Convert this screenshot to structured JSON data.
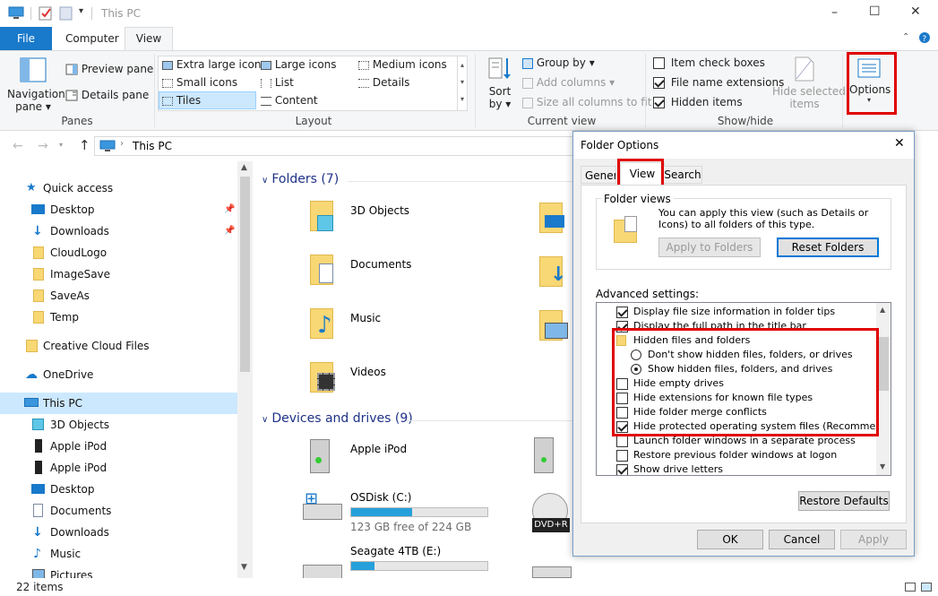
{
  "window": {
    "title": "This PC",
    "controls": [
      "–",
      "☐",
      "✕"
    ]
  },
  "ribbon": {
    "tabs": {
      "file": "File",
      "computer": "Computer",
      "view": "View"
    },
    "panes": {
      "navigation": "Navigation pane",
      "nav_line1": "Navigation",
      "nav_line2": "pane",
      "preview": "Preview pane",
      "details": "Details pane",
      "label": "Panes"
    },
    "layout": {
      "extra_large": "Extra large icons",
      "large": "Large icons",
      "medium": "Medium icons",
      "small": "Small icons",
      "list": "List",
      "details": "Details",
      "tiles": "Tiles",
      "content": "Content",
      "label": "Layout"
    },
    "current_view": {
      "sort1": "Sort",
      "sort2": "by",
      "group_by": "Group by",
      "add_columns": "Add columns",
      "size_all": "Size all columns to fit",
      "label": "Current view"
    },
    "show_hide": {
      "item_check_boxes": "Item check boxes",
      "file_name_ext": "File name extensions",
      "hidden_items": "Hidden items",
      "hide_selected1": "Hide selected",
      "hide_selected2": "items",
      "label": "Show/hide"
    },
    "options": {
      "label": "Options"
    }
  },
  "address": {
    "path": "This PC"
  },
  "nav": {
    "quick_access": "Quick access",
    "items": [
      "Desktop",
      "Downloads",
      "CloudLogo",
      "ImageSave",
      "SaveAs",
      "Temp"
    ],
    "creative_cloud": "Creative Cloud Files",
    "onedrive": "OneDrive",
    "this_pc": "This PC",
    "pc_items": [
      "3D Objects",
      "Apple iPod",
      "Apple iPod",
      "Desktop",
      "Documents",
      "Downloads",
      "Music",
      "Pictures"
    ]
  },
  "content": {
    "folders_header": "Folders (7)",
    "folders": [
      "3D Objects",
      "Documents",
      "Music",
      "Videos"
    ],
    "devices_header": "Devices and drives (9)",
    "devices": [
      {
        "name": "Apple iPod",
        "free": ""
      },
      {
        "name": "OSDisk (C:)",
        "free": "123 GB free of 224 GB",
        "fill": 0.45
      },
      {
        "name": "Seagate 4TB (E:)",
        "free": "",
        "fill": 0.17
      }
    ],
    "dvd_label": "DVD+R"
  },
  "status": {
    "items": "22 items"
  },
  "dialog": {
    "title": "Folder Options",
    "tabs": {
      "general": "General",
      "view": "View",
      "search": "Search"
    },
    "folder_views": {
      "label": "Folder views",
      "description": "You can apply this view (such as Details or Icons) to all folders of this type.",
      "apply_button": "Apply to Folders",
      "reset_button": "Reset Folders"
    },
    "advanced_label": "Advanced settings:",
    "settings": [
      {
        "text": "Display file size information in folder tips",
        "kind": "check",
        "on": true
      },
      {
        "text": "Display the full path in the title bar",
        "kind": "check",
        "on": true
      },
      {
        "text": "Hidden files and folders",
        "kind": "folder",
        "on": false
      },
      {
        "text": "Don't show hidden files, folders, or drives",
        "kind": "radio",
        "on": false
      },
      {
        "text": "Show hidden files, folders, and drives",
        "kind": "radio",
        "on": true
      },
      {
        "text": "Hide empty drives",
        "kind": "check",
        "on": false
      },
      {
        "text": "Hide extensions for known file types",
        "kind": "check",
        "on": false
      },
      {
        "text": "Hide folder merge conflicts",
        "kind": "check",
        "on": false
      },
      {
        "text": "Hide protected operating system files (Recommended)",
        "kind": "check",
        "on": true
      },
      {
        "text": "Launch folder windows in a separate process",
        "kind": "check",
        "on": false
      },
      {
        "text": "Restore previous folder windows at logon",
        "kind": "check",
        "on": false
      },
      {
        "text": "Show drive letters",
        "kind": "check",
        "on": true
      }
    ],
    "restore_defaults": "Restore Defaults",
    "ok": "OK",
    "cancel": "Cancel",
    "apply": "Apply"
  }
}
